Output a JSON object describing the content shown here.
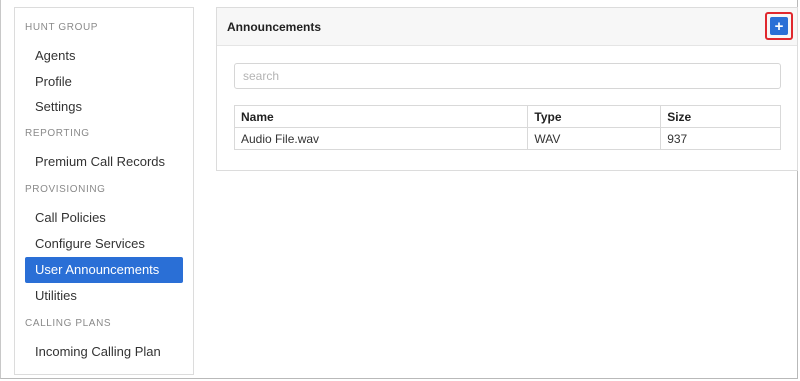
{
  "sidebar": {
    "sections": [
      {
        "header": "HUNT GROUP",
        "items": [
          "Agents",
          "Profile",
          "Settings"
        ]
      },
      {
        "header": "REPORTING",
        "items": [
          "Premium Call Records"
        ]
      },
      {
        "header": "PROVISIONING",
        "items": [
          "Call Policies",
          "Configure Services",
          "User Announcements",
          "Utilities"
        ]
      },
      {
        "header": "CALLING PLANS",
        "items": [
          "Incoming Calling Plan"
        ]
      }
    ],
    "active_item": "User Announcements"
  },
  "panel": {
    "title": "Announcements",
    "add_button_label": "+",
    "search": {
      "placeholder": "search",
      "value": ""
    },
    "table": {
      "columns": [
        "Name",
        "Type",
        "Size"
      ],
      "rows": [
        [
          "Audio File.wav",
          "WAV",
          "937"
        ]
      ]
    }
  },
  "colors": {
    "accent": "#2a6fd6",
    "highlight": "#e0282e"
  }
}
